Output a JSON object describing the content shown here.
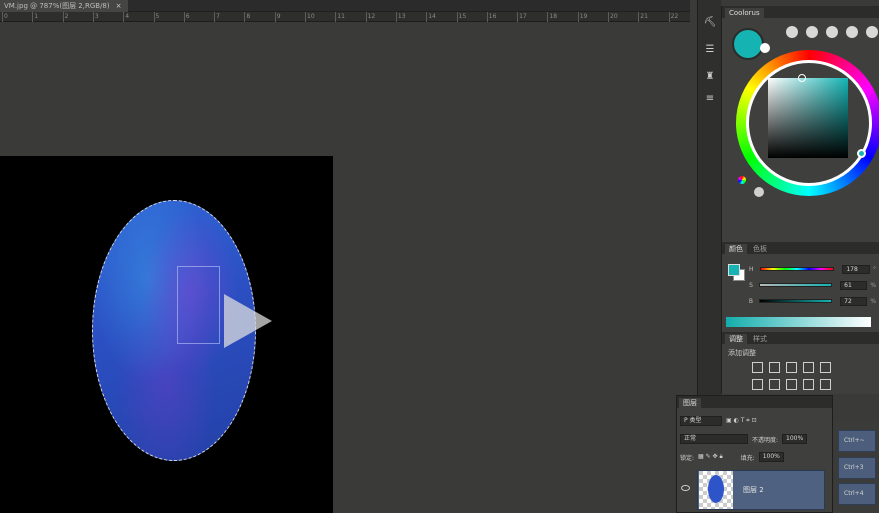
{
  "document": {
    "tab_title": "VM.jpg @ 787%(图层 2,RGB/8)",
    "close_glyph": "×"
  },
  "ruler": {
    "labels": [
      "0",
      "1",
      "2",
      "3",
      "4",
      "5",
      "6",
      "7",
      "8",
      "9",
      "10",
      "11",
      "12",
      "13",
      "14",
      "15",
      "16",
      "17",
      "18",
      "19",
      "20",
      "21",
      "22"
    ]
  },
  "canvas": {
    "shape": "oval-selection",
    "play_overlay": "play-icon"
  },
  "coolorus": {
    "title": "Coolorus",
    "fg_color": "#16b3b3",
    "bg_color": "#ffffff"
  },
  "color_panel": {
    "tabs": [
      "颜色",
      "色板"
    ],
    "sliders": [
      {
        "label": "H",
        "value": "178",
        "unit": "°"
      },
      {
        "label": "S",
        "value": "61",
        "unit": "%"
      },
      {
        "label": "B",
        "value": "72",
        "unit": "%"
      }
    ]
  },
  "adjustments": {
    "tabs": [
      "调整",
      "样式"
    ],
    "title": "添加调整"
  },
  "layers": {
    "tabs": [
      "图层"
    ],
    "filter_label": "P 类型",
    "blend_mode": "正常",
    "opacity_label": "不透明度:",
    "opacity_value": "100%",
    "lock_label": "锁定:",
    "fill_label": "填充:",
    "fill_value": "100%",
    "layer_name": "图层 2"
  },
  "shortcuts": [
    "Ctrl+~",
    "Ctrl+3",
    "Ctrl+4"
  ]
}
